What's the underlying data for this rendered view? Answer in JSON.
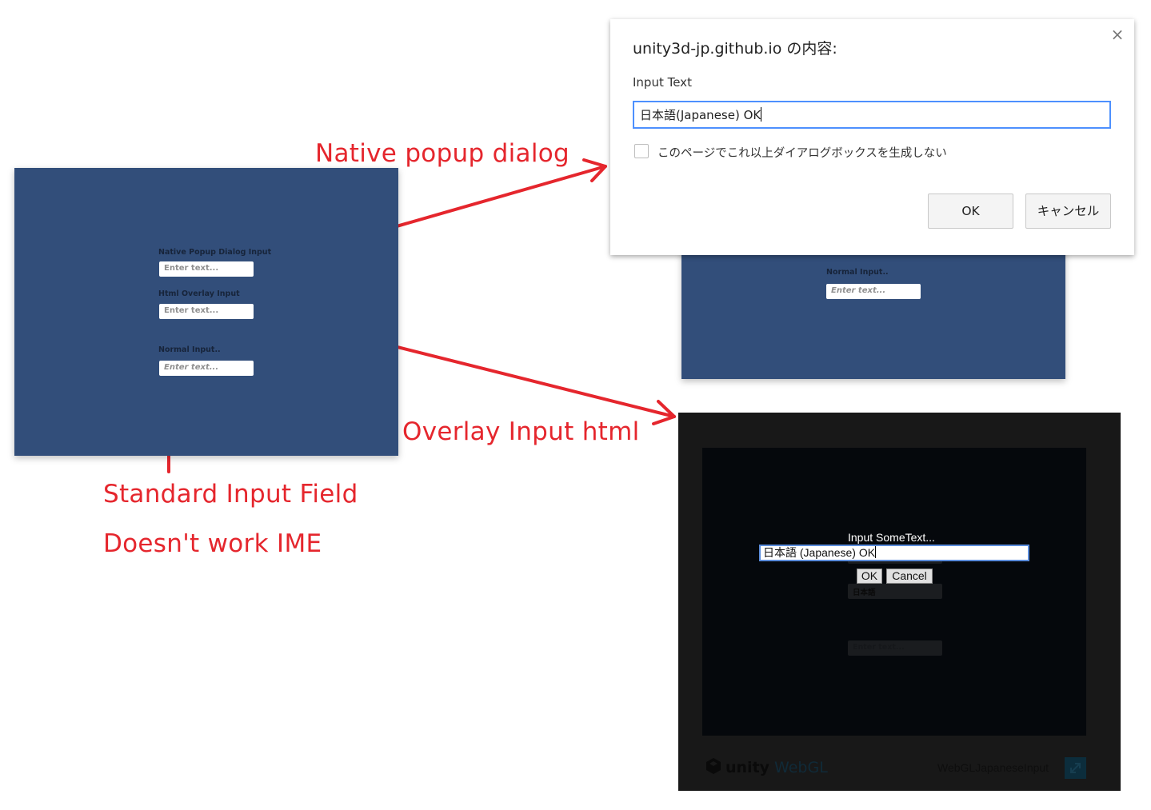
{
  "left_panel": {
    "native_label": "Native Popup Dialog Input",
    "native_placeholder": "Enter text...",
    "overlay_label": "Html Overlay Input",
    "overlay_placeholder": "Enter text...",
    "normal_label": "Normal Input..",
    "normal_placeholder": "Enter text..."
  },
  "annotations": {
    "native": "Native popup dialog",
    "overlay": "Overlay Input html",
    "standard_line1": "Standard Input Field",
    "standard_line2": "Doesn't work IME"
  },
  "dialog": {
    "title": "unity3d-jp.github.io の内容:",
    "close_icon": "×",
    "prompt": "Input Text",
    "input_value": "日本語(Japanese) OK",
    "checkbox_label": "このページでこれ以上ダイアログボックスを生成しない",
    "ok_label": "OK",
    "cancel_label": "キャンセル",
    "background_normal_label": "Normal Input..",
    "background_normal_placeholder": "Enter text..."
  },
  "overlay": {
    "title": "Input SomeText...",
    "input_value": "日本語 (Japanese) OK",
    "ghost_text": "apanese) OK",
    "ok_label": "OK",
    "cancel_label": "Cancel",
    "dim_value": "日本語",
    "dim_placeholder": "Enter text...",
    "logo_text": "unity",
    "logo_webgl": "WebGL",
    "build_name": "WebGLJapaneseInput"
  },
  "colors": {
    "unity_blue": "#324e7a",
    "annotation_red": "#e5262d",
    "focus_blue": "#4d90fe"
  },
  "icons": {
    "close": "close-icon",
    "fullscreen": "fullscreen-icon",
    "unity_logo": "unity-logo-icon"
  }
}
